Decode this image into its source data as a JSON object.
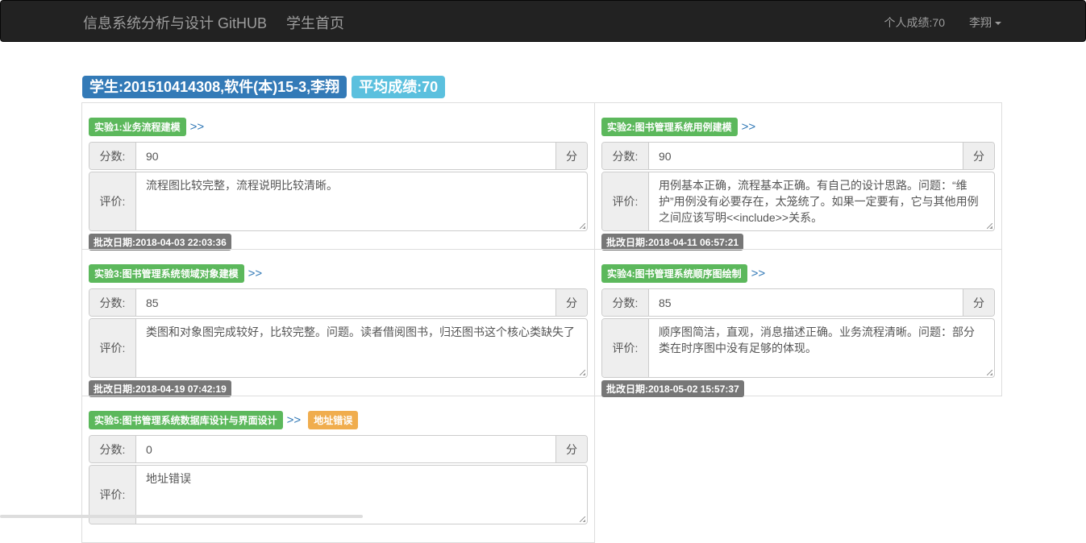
{
  "navbar": {
    "brand": "信息系统分析与设计 GitHUB",
    "home": "学生首页",
    "score": "个人成绩:70",
    "user": "李翔"
  },
  "header": {
    "student": "学生:201510414308,软件(本)15-3,李翔",
    "average": "平均成绩:70"
  },
  "colors": {
    "primary": "#337ab7",
    "info": "#5bc0de",
    "success": "#5cb85c",
    "warning": "#f0ad4e",
    "default": "#777777"
  },
  "labels": {
    "score": "分数:",
    "unit": "分",
    "comment": "评价:",
    "link": ">>"
  },
  "experiments": [
    {
      "title": "实验1:业务流程建模",
      "score": "90",
      "comment": "流程图比较完整，流程说明比较清晰。",
      "date": "批改日期:2018-04-03 22:03:36"
    },
    {
      "title": "实验2:图书管理系统用例建模",
      "score": "90",
      "comment": "用例基本正确，流程基本正确。有自己的设计思路。问题：“维护”用例没有必要存在，太笼统了。如果一定要有，它与其他用例之间应该写明<<include>>关系。",
      "date": "批改日期:2018-04-11 06:57:21"
    },
    {
      "title": "实验3:图书管理系统领域对象建模",
      "score": "85",
      "comment": "类图和对象图完成较好，比较完整。问题。读者借阅图书，归还图书这个核心类缺失了",
      "date": "批改日期:2018-04-19 07:42:19"
    },
    {
      "title": "实验4:图书管理系统顺序图绘制",
      "score": "85",
      "comment": "顺序图简洁，直观，消息描述正确。业务流程清晰。问题：部分类在时序图中没有足够的体现。",
      "date": "批改日期:2018-05-02 15:57:37"
    },
    {
      "title": "实验5:图书管理系统数据库设计与界面设计",
      "score": "0",
      "comment": "地址错误",
      "warning": "地址错误",
      "date": ""
    }
  ]
}
